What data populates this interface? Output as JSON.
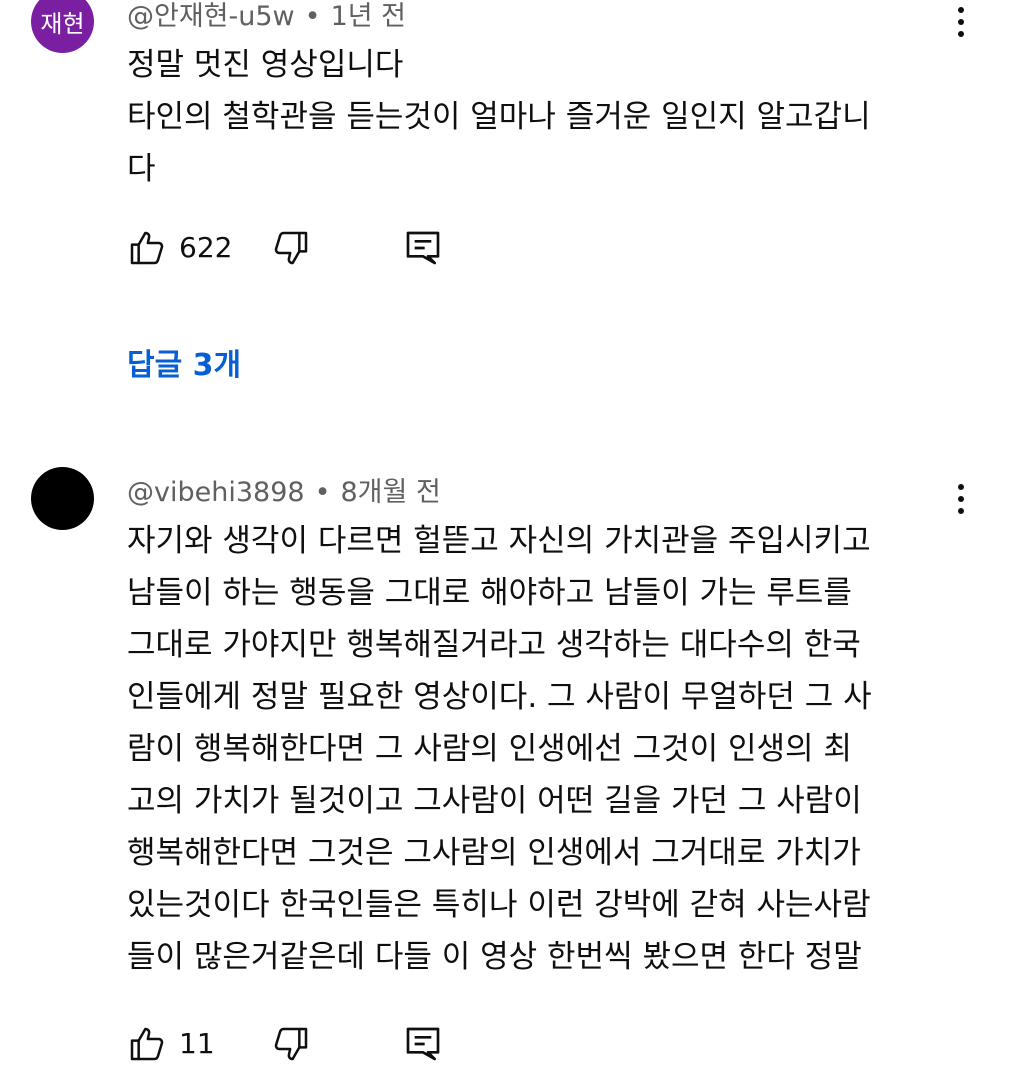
{
  "comments": [
    {
      "avatar_text": "재현",
      "avatar_color": "#7b1fa2",
      "author": "@안재현-u5w",
      "separator": "•",
      "time": "1년 전",
      "lines": [
        "정말 멋진 영상입니다",
        "타인의 철학관을 듣는것이 얼마나 즐거운 일인지 알고갑니",
        "다"
      ],
      "likes": "622",
      "replies_label": "답글 3개"
    },
    {
      "avatar_text": "",
      "avatar_color": "#000000",
      "author": "@vibehi3898",
      "separator": "•",
      "time": "8개월 전",
      "lines": [
        "자기와 생각이 다르면 헐뜯고 자신의 가치관을 주입시키고",
        "남들이 하는 행동을 그대로 해야하고 남들이 가는 루트를",
        "그대로 가야지만 행복해질거라고 생각하는 대다수의 한국",
        "인들에게 정말 필요한 영상이다. 그 사람이 무얼하던 그 사",
        "람이 행복해한다면 그 사람의 인생에선 그것이 인생의 최",
        "고의 가치가 될것이고 그사람이 어떤 길을 가던 그 사람이",
        "행복해한다면 그것은 그사람의 인생에서 그거대로 가치가",
        "있는것이다 한국인들은 특히나 이런 강박에 갇혀 사는사람",
        "들이 많은거같은데 다들 이 영상 한번씩 봤으면 한다 정말"
      ],
      "likes": "11"
    }
  ],
  "icons": {
    "like": "thumbs-up-icon",
    "dislike": "thumbs-down-icon",
    "reply": "reply-comment-icon",
    "menu": "more-vertical-icon"
  },
  "colors": {
    "text": "#0f0f0f",
    "meta": "#606060",
    "link": "#065fd4"
  }
}
